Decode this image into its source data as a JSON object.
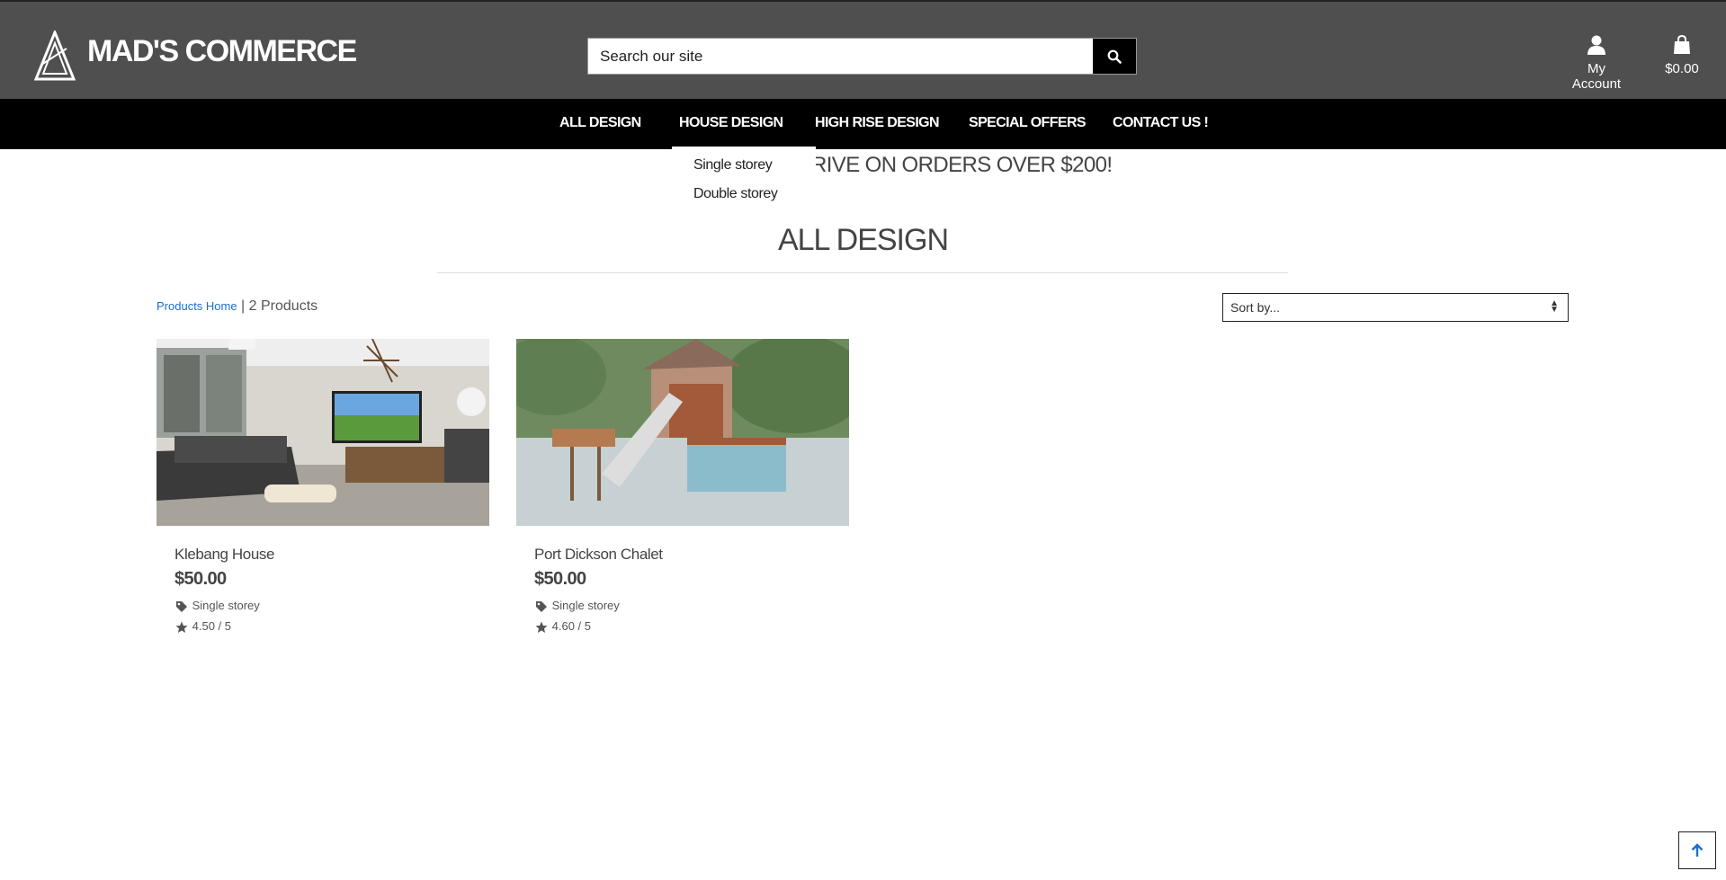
{
  "header": {
    "brand": "MAD'S COMMERCE",
    "search_placeholder": "Search our site",
    "account_label": "My Account",
    "bag_total": "$0.00"
  },
  "nav": {
    "items": [
      "ALL DESIGN",
      "HOUSE DESIGN",
      "HIGH RISE DESIGN",
      "SPECIAL OFFERS",
      "CONTACT US !"
    ],
    "dropdown": [
      "Single storey",
      "Double storey"
    ]
  },
  "banner": {
    "text": "RIVE ON ORDERS OVER $200!"
  },
  "page": {
    "title": "ALL DESIGN",
    "breadcrumb_link": "Products Home",
    "breadcrumb_sep": "|",
    "product_count": "2 Products",
    "sort_label": "Sort by..."
  },
  "products": [
    {
      "name": "Klebang House",
      "price": "$50.00",
      "category": "Single storey",
      "rating": "4.50 / 5"
    },
    {
      "name": "Port Dickson Chalet",
      "price": "$50.00",
      "category": "Single storey",
      "rating": "4.60 / 5"
    }
  ],
  "colors": {
    "header_bg": "#4f4f4f",
    "nav_bg": "#000000",
    "link": "#1b6fd1"
  },
  "icons": [
    "logo-icon",
    "search-icon",
    "user-icon",
    "shopping-bag-icon",
    "tag-icon",
    "star-icon",
    "arrow-up-icon",
    "sort-arrows-icon"
  ]
}
